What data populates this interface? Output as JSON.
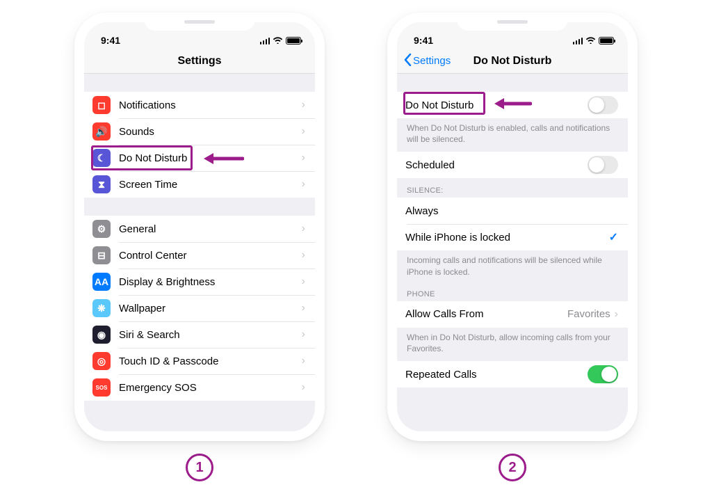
{
  "status": {
    "time": "9:41"
  },
  "phone1": {
    "title": "Settings",
    "rows1": [
      {
        "label": "Notifications",
        "icon": "notifications-icon",
        "color": "ic-red",
        "glyph": "◻︎"
      },
      {
        "label": "Sounds",
        "icon": "sounds-icon",
        "color": "ic-red",
        "glyph": "🔊"
      },
      {
        "label": "Do Not Disturb",
        "icon": "dnd-icon",
        "color": "ic-purple",
        "glyph": "☾"
      },
      {
        "label": "Screen Time",
        "icon": "screentime-icon",
        "color": "ic-purple",
        "glyph": "⧗"
      }
    ],
    "rows2": [
      {
        "label": "General",
        "icon": "general-icon",
        "color": "ic-gray",
        "glyph": "⚙"
      },
      {
        "label": "Control Center",
        "icon": "control-center-icon",
        "color": "ic-gray",
        "glyph": "⊟"
      },
      {
        "label": "Display & Brightness",
        "icon": "display-icon",
        "color": "ic-blue",
        "glyph": "AA"
      },
      {
        "label": "Wallpaper",
        "icon": "wallpaper-icon",
        "color": "ic-cyan",
        "glyph": "❋"
      },
      {
        "label": "Siri & Search",
        "icon": "siri-icon",
        "color": "ic-dark",
        "glyph": "◉"
      },
      {
        "label": "Touch ID & Passcode",
        "icon": "touchid-icon",
        "color": "ic-red",
        "glyph": "◎"
      },
      {
        "label": "Emergency SOS",
        "icon": "sos-icon",
        "color": "ic-red",
        "glyph": "SOS"
      }
    ]
  },
  "phone2": {
    "back": "Settings",
    "title": "Do Not Disturb",
    "dnd": {
      "label": "Do Not Disturb",
      "footer": "When Do Not Disturb is enabled, calls and notifications will be silenced."
    },
    "scheduled": {
      "label": "Scheduled"
    },
    "silence": {
      "header": "SILENCE:",
      "always": "Always",
      "locked": "While iPhone is locked",
      "footer": "Incoming calls and notifications will be silenced while iPhone is locked."
    },
    "phone": {
      "header": "PHONE",
      "allow_label": "Allow Calls From",
      "allow_value": "Favorites",
      "allow_footer": "When in Do Not Disturb, allow incoming calls from your Favorites.",
      "repeated": "Repeated Calls"
    }
  },
  "steps": {
    "one": "1",
    "two": "2"
  }
}
